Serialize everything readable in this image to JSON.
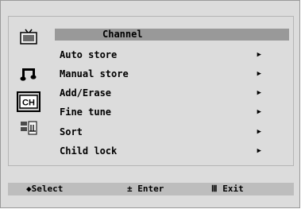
{
  "menu": {
    "title": "Channel",
    "items": [
      {
        "label": "Auto store",
        "arrow": "▶"
      },
      {
        "label": "Manual store",
        "arrow": "▶"
      },
      {
        "label": "Add/Erase",
        "arrow": "▶"
      },
      {
        "label": "Fine tune",
        "arrow": "▶"
      },
      {
        "label": "Sort",
        "arrow": "▶"
      },
      {
        "label": "Child lock",
        "arrow": "▶"
      }
    ]
  },
  "icons": [
    {
      "name": "tv-picture-icon"
    },
    {
      "name": "sound-note-icon"
    },
    {
      "name": "channel-icon",
      "text": "CH",
      "active": true
    },
    {
      "name": "setup-icon"
    }
  ],
  "footer": {
    "select_glyph": "◆",
    "select_label": "Select",
    "enter_glyph": "±",
    "enter_label": "Enter",
    "exit_glyph": "Ⅲ",
    "exit_label": "Exit"
  }
}
